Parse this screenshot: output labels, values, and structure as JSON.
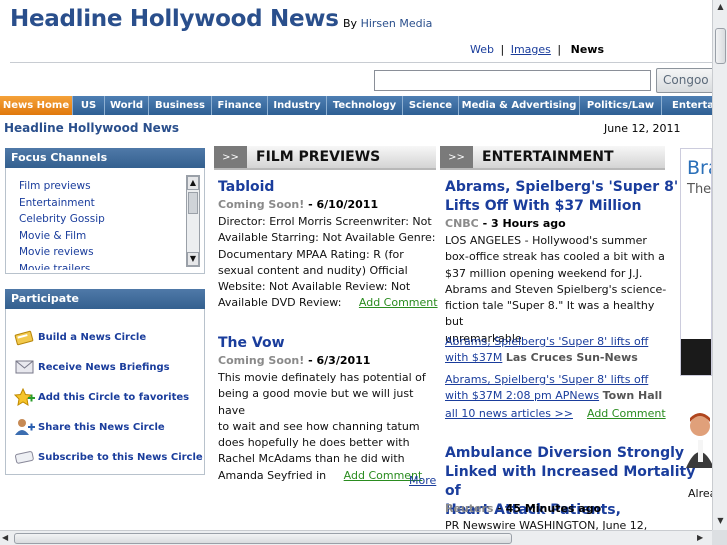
{
  "header": {
    "title": "Headline Hollywood News",
    "by": "By",
    "publisher": "Hirsen Media",
    "search_tabs": [
      {
        "label": "Web",
        "active": false
      },
      {
        "label": "Images",
        "active": false
      },
      {
        "label": "News",
        "active": true
      }
    ],
    "search_placeholder": "",
    "search_button": "Congoo"
  },
  "nav": [
    {
      "label": "News Home",
      "active": true
    },
    {
      "label": "US"
    },
    {
      "label": "World"
    },
    {
      "label": "Business"
    },
    {
      "label": "Finance"
    },
    {
      "label": "Industry"
    },
    {
      "label": "Technology"
    },
    {
      "label": "Science"
    },
    {
      "label": "Media & Advertising"
    },
    {
      "label": "Politics/Law"
    },
    {
      "label": "Entertain"
    }
  ],
  "subheader": {
    "title": "Headline Hollywood News",
    "date": "June 12, 2011"
  },
  "focus_channels": {
    "title": "Focus Channels",
    "items": [
      "Film previews",
      "Entertainment",
      "Celebrity Gossip",
      "Movie & Film",
      "Movie reviews",
      "Movie trailers"
    ]
  },
  "participate": {
    "title": "Participate",
    "items": [
      {
        "label": "Build a News Circle",
        "icon": "news-circle-icon"
      },
      {
        "label": "Receive News Briefings",
        "icon": "envelope-icon"
      },
      {
        "label": "Add this Circle to favorites",
        "icon": "favorites-icon"
      },
      {
        "label": "Share this News Circle",
        "icon": "share-user-icon"
      },
      {
        "label": "Subscribe to this News Circle",
        "icon": "subscribe-icon"
      }
    ]
  },
  "film_previews": {
    "arrow": ">>",
    "title": "FILM PREVIEWS",
    "stories": [
      {
        "title": "Tabloid",
        "status": "Coming Soon!",
        "date": " - 6/10/2011",
        "body_lines": [
          "Director: Errol Morris Screenwriter: Not",
          "Available Starring: Not Available Genre:",
          "Documentary MPAA Rating: R (for",
          "sexual content and nudity) Official",
          "Website: Not Available Review: Not"
        ],
        "last_line": "Available DVD Review:",
        "comment": "Add Comment"
      },
      {
        "title": "The Vow",
        "status": "Coming Soon!",
        "date": " - 6/3/2011",
        "body_lines": [
          "This movie definately has potential of",
          "being a good movie but we will just have",
          "to wait and see how channing tatum",
          "does hopefully he does better with",
          "Rachel McAdams than he did with"
        ],
        "last_line": "Amanda Seyfried in",
        "comment": "Add Comment"
      }
    ],
    "more": "More"
  },
  "entertainment": {
    "arrow": ">>",
    "title": "ENTERTAINMENT",
    "story1": {
      "title_lines": [
        "Abrams, Spielberg's 'Super 8'",
        "Lifts Off With $37 Million"
      ],
      "source": "CNBC",
      "when": " - 3 Hours ago",
      "body_lines": [
        "LOS ANGELES - Hollywood's summer",
        "box-office streak has cooled a bit with a",
        "$37 million opening weekend for J.J.",
        "Abrams and Steven Spielberg's science-",
        "fiction tale \"Super 8.\" It was a healthy but",
        "unremarkable"
      ],
      "related1_line1": "Abrams, Spielberg's 'Super 8' lifts off",
      "related1_line2": "with $37M",
      "related1_source": "Las Cruces Sun-News",
      "related2_line1": "Abrams, Spielberg's 'Super 8' lifts off",
      "related2_line2": "with $37M 2:08 pm APNews",
      "related2_source": "Town Hall",
      "all_articles": "all 10 news articles >>",
      "comment": "Add Comment"
    },
    "story2": {
      "title_lines": [
        "Ambulance Diversion Strongly",
        "Linked with Increased Mortality of",
        "Heart Attack Patients,"
      ],
      "source": "Reuters",
      "when": " - 45 Minutes ago",
      "body_first": "PR Newswire WASHINGTON, June 12,"
    }
  },
  "ads": {
    "ad1_line1": "Bra",
    "ad1_line2": "The",
    "ad2_text": "Alrea"
  }
}
